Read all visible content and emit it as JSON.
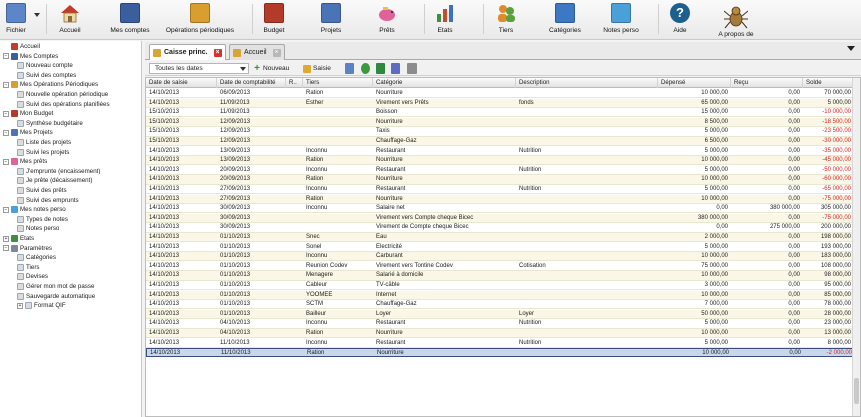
{
  "toolbar": [
    {
      "id": "fichier",
      "label": "Fichier",
      "icon": "folder-icon"
    },
    {
      "id": "accueil",
      "label": "Accueil",
      "icon": "house-icon"
    },
    {
      "id": "mes-comptes",
      "label": "Mes comptes",
      "icon": "accounts-icon"
    },
    {
      "id": "operations-periodiques",
      "label": "Opérations périodiques",
      "icon": "calendar-icon"
    },
    {
      "id": "budget",
      "label": "Budget",
      "icon": "budget-icon"
    },
    {
      "id": "projets",
      "label": "Projets",
      "icon": "projects-icon"
    },
    {
      "id": "prets",
      "label": "Prêts",
      "icon": "piggy-bank-icon"
    },
    {
      "id": "etats",
      "label": "Etats",
      "icon": "bar-chart-icon"
    },
    {
      "id": "tiers",
      "label": "Tiers",
      "icon": "people-icon"
    },
    {
      "id": "categories",
      "label": "Catégories",
      "icon": "list-icon"
    },
    {
      "id": "notes-perso",
      "label": "Notes perso",
      "icon": "notes-icon"
    },
    {
      "id": "aide",
      "label": "Aide",
      "icon": "help-icon"
    },
    {
      "id": "a-propos",
      "label": "A propos de",
      "icon": "spider-icon"
    }
  ],
  "tree": [
    {
      "label": "Accueil",
      "level": 0,
      "expander": "",
      "icon": "house-icon"
    },
    {
      "label": "Mes Comptes",
      "level": 0,
      "expander": "−",
      "icon": "accounts-icon"
    },
    {
      "label": "Nouveau compte",
      "level": 1,
      "expander": "",
      "icon": "doc-icon"
    },
    {
      "label": "Suivi des comptes",
      "level": 1,
      "expander": "",
      "icon": "doc-icon"
    },
    {
      "label": "Mes Opérations Périodiques",
      "level": 0,
      "expander": "−",
      "icon": "calendar-icon"
    },
    {
      "label": "Nouvelle opération périodique",
      "level": 1,
      "expander": "",
      "icon": "doc-icon"
    },
    {
      "label": "Suivi des opérations planifiées",
      "level": 1,
      "expander": "",
      "icon": "doc-icon"
    },
    {
      "label": "Mon Budget",
      "level": 0,
      "expander": "−",
      "icon": "budget-icon"
    },
    {
      "label": "Synthèse budgétaire",
      "level": 1,
      "expander": "",
      "icon": "doc-icon"
    },
    {
      "label": "Mes Projets",
      "level": 0,
      "expander": "−",
      "icon": "projects-icon"
    },
    {
      "label": "Liste des projets",
      "level": 1,
      "expander": "",
      "icon": "doc-icon"
    },
    {
      "label": "Suivi les projets",
      "level": 1,
      "expander": "",
      "icon": "doc-icon"
    },
    {
      "label": "Mes prêts",
      "level": 0,
      "expander": "−",
      "icon": "piggy-bank-icon"
    },
    {
      "label": "J'emprunte (encaissement)",
      "level": 1,
      "expander": "",
      "icon": "doc-icon"
    },
    {
      "label": "Je prête (décaissement)",
      "level": 1,
      "expander": "",
      "icon": "doc-icon"
    },
    {
      "label": "Suivi des prêts",
      "level": 1,
      "expander": "",
      "icon": "doc-icon"
    },
    {
      "label": "Suivi des emprunts",
      "level": 1,
      "expander": "",
      "icon": "doc-icon"
    },
    {
      "label": "Mes notes perso",
      "level": 0,
      "expander": "−",
      "icon": "notes-icon"
    },
    {
      "label": "Types de notes",
      "level": 1,
      "expander": "",
      "icon": "doc-icon"
    },
    {
      "label": "Notes perso",
      "level": 1,
      "expander": "",
      "icon": "doc-icon"
    },
    {
      "label": "Etats",
      "level": 0,
      "expander": "+",
      "icon": "bar-chart-icon"
    },
    {
      "label": "Paramètres",
      "level": 0,
      "expander": "−",
      "icon": "settings-icon"
    },
    {
      "label": "Catégories",
      "level": 1,
      "expander": "",
      "icon": "doc-icon"
    },
    {
      "label": "Tiers",
      "level": 1,
      "expander": "",
      "icon": "doc-icon"
    },
    {
      "label": "Devises",
      "level": 1,
      "expander": "",
      "icon": "doc-icon"
    },
    {
      "label": "Gérer mon mot de passe",
      "level": 1,
      "expander": "",
      "icon": "doc-icon"
    },
    {
      "label": "Sauvegarde automatique",
      "level": 1,
      "expander": "",
      "icon": "doc-icon"
    },
    {
      "label": "Format QIF",
      "level": 1,
      "expander": "+",
      "icon": "doc-icon"
    }
  ],
  "tabs": [
    {
      "label": "Caisse princ.",
      "active": true
    },
    {
      "label": "Accueil",
      "active": false
    }
  ],
  "gridtools": {
    "filter_value": "Toutes les dates",
    "new_label": "Nouveau",
    "entry_label": "Saisie"
  },
  "grid": {
    "columns": [
      "Date de saisie",
      "Date de comptabilité",
      "R..",
      "Tiers",
      "Catégorie",
      "Description",
      "Dépensé",
      "Reçu",
      "Solde"
    ],
    "rows": [
      [
        "14/10/2013",
        "06/09/2013",
        "",
        "Ration",
        "Nourriture",
        "",
        "10 000,00",
        "0,00",
        "70 000,00"
      ],
      [
        "14/10/2013",
        "11/09/2013",
        "",
        "Esther",
        "Virement vers Prêts",
        "fonds",
        "65 000,00",
        "0,00",
        "5 000,00"
      ],
      [
        "15/10/2013",
        "11/09/2013",
        "",
        "",
        "Boisson",
        "",
        "15 000,00",
        "0,00",
        "-10 000,00"
      ],
      [
        "15/10/2013",
        "12/09/2013",
        "",
        "",
        "Nourriture",
        "",
        "8 500,00",
        "0,00",
        "-18 500,00"
      ],
      [
        "15/10/2013",
        "12/09/2013",
        "",
        "",
        "Taxis",
        "",
        "5 000,00",
        "0,00",
        "-23 500,00"
      ],
      [
        "15/10/2013",
        "12/09/2013",
        "",
        "",
        "Chauffage-Gaz",
        "",
        "6 500,00",
        "0,00",
        "-30 000,00"
      ],
      [
        "14/10/2013",
        "13/09/2013",
        "",
        "Inconnu",
        "Restaurant",
        "Nutrition",
        "5 000,00",
        "0,00",
        "-35 000,00"
      ],
      [
        "14/10/2013",
        "13/09/2013",
        "",
        "Ration",
        "Nourriture",
        "",
        "10 000,00",
        "0,00",
        "-45 000,00"
      ],
      [
        "14/10/2013",
        "20/09/2013",
        "",
        "Inconnu",
        "Restaurant",
        "Nutrition",
        "5 000,00",
        "0,00",
        "-50 000,00"
      ],
      [
        "14/10/2013",
        "20/09/2013",
        "",
        "Ration",
        "Nourriture",
        "",
        "10 000,00",
        "0,00",
        "-60 000,00"
      ],
      [
        "14/10/2013",
        "27/09/2013",
        "",
        "Inconnu",
        "Restaurant",
        "Nutrition",
        "5 000,00",
        "0,00",
        "-65 000,00"
      ],
      [
        "14/10/2013",
        "27/09/2013",
        "",
        "Ration",
        "Nourriture",
        "",
        "10 000,00",
        "0,00",
        "-75 000,00"
      ],
      [
        "14/10/2013",
        "30/09/2013",
        "",
        "Inconnu",
        "Salaire net",
        "",
        "0,00",
        "380 000,00",
        "305 000,00"
      ],
      [
        "14/10/2013",
        "30/09/2013",
        "",
        "",
        "Virement vers Compte cheque Bicec",
        "",
        "380 000,00",
        "0,00",
        "-75 000,00"
      ],
      [
        "14/10/2013",
        "30/09/2013",
        "",
        "",
        "Virement de Compte cheque Bicec",
        "",
        "0,00",
        "275 000,00",
        "200 000,00"
      ],
      [
        "14/10/2013",
        "01/10/2013",
        "",
        "Snec",
        "Eau",
        "",
        "2 000,00",
        "0,00",
        "198 000,00"
      ],
      [
        "14/10/2013",
        "01/10/2013",
        "",
        "Sonel",
        "Electricité",
        "",
        "5 000,00",
        "0,00",
        "193 000,00"
      ],
      [
        "14/10/2013",
        "01/10/2013",
        "",
        "Inconnu",
        "Carburant",
        "",
        "10 000,00",
        "0,00",
        "183 000,00"
      ],
      [
        "14/10/2013",
        "01/10/2013",
        "",
        "Reunion Codev",
        "Virement vers Tontine Codev",
        "Cotisation",
        "75 000,00",
        "0,00",
        "108 000,00"
      ],
      [
        "14/10/2013",
        "01/10/2013",
        "",
        "Menagere",
        "Salarié à domicile",
        "",
        "10 000,00",
        "0,00",
        "98 000,00"
      ],
      [
        "14/10/2013",
        "01/10/2013",
        "",
        "Cableur",
        "TV-câble",
        "",
        "3 000,00",
        "0,00",
        "95 000,00"
      ],
      [
        "14/10/2013",
        "01/10/2013",
        "",
        "YOOMEE",
        "Internet",
        "",
        "10 000,00",
        "0,00",
        "85 000,00"
      ],
      [
        "14/10/2013",
        "01/10/2013",
        "",
        "SCTM",
        "Chauffage-Gaz",
        "",
        "7 000,00",
        "0,00",
        "78 000,00"
      ],
      [
        "14/10/2013",
        "01/10/2013",
        "",
        "Bailleur",
        "Loyer",
        "Loyer",
        "50 000,00",
        "0,00",
        "28 000,00"
      ],
      [
        "14/10/2013",
        "04/10/2013",
        "",
        "Inconnu",
        "Restaurant",
        "Nutrition",
        "5 000,00",
        "0,00",
        "23 000,00"
      ],
      [
        "14/10/2013",
        "04/10/2013",
        "",
        "Ration",
        "Nourriture",
        "",
        "10 000,00",
        "0,00",
        "13 000,00"
      ],
      [
        "14/10/2013",
        "11/10/2013",
        "",
        "Inconnu",
        "Restaurant",
        "Nutrition",
        "5 000,00",
        "0,00",
        "8 000,00"
      ],
      [
        "14/10/2013",
        "11/10/2013",
        "",
        "Ration",
        "Nourriture",
        "",
        "10 000,00",
        "0,00",
        "-2 000,00"
      ]
    ]
  },
  "colors": {
    "negative": "#e02020",
    "selected_row": "#c9d6ec",
    "alt_row": "#fbf7e6",
    "tab_close": "#d9322b"
  }
}
